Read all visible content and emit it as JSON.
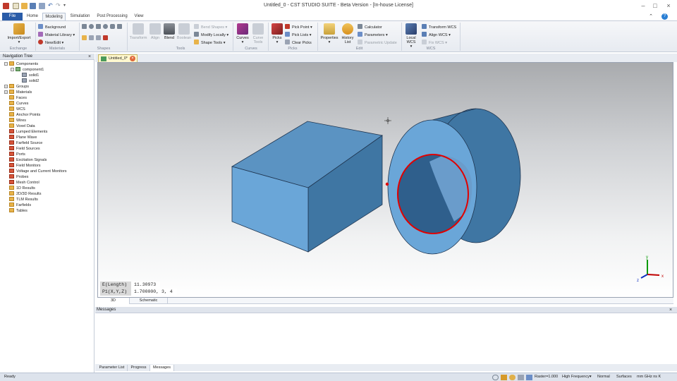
{
  "window": {
    "title": "Untitled_0 - CST STUDIO SUITE - Beta Version - [In-house License]"
  },
  "tabs": [
    "File",
    "Home",
    "Modeling",
    "Simulation",
    "Post Processing",
    "View"
  ],
  "ribbon": {
    "exchange": {
      "import_export": "Import/Export",
      "group": "Exchange"
    },
    "materials": {
      "background": "Background",
      "library": "Material Library",
      "new_edit": "New/Edit",
      "group": "Materials"
    },
    "shapes": {
      "group": "Shapes"
    },
    "tools": {
      "transform": "Transform",
      "align": "Align",
      "blend": "Blend",
      "boolean": "Boolean",
      "bend_shapes": "Bend Shapes",
      "modify_locally": "Modify Locally",
      "shape_tools": "Shape Tools",
      "group": "Tools"
    },
    "curves": {
      "curves": "Curves",
      "curve_tools": "Curve Tools",
      "group": "Curves"
    },
    "picks": {
      "picks": "Picks",
      "pick_point": "Pick Point",
      "pick_lists": "Pick Lists",
      "clear_picks": "Clear Picks",
      "group": "Picks"
    },
    "edit": {
      "properties": "Properties",
      "history": "History List",
      "calculator": "Calculator",
      "parameters": "Parameters",
      "param_update": "Parametric Update",
      "group": "Edit"
    },
    "wcs": {
      "local": "Local WCS",
      "transform": "Transform WCS",
      "align": "Align WCS",
      "fix": "Fix WCS",
      "group": "WCS"
    }
  },
  "nav": {
    "title": "Navigation Tree",
    "tree": [
      {
        "label": "Components",
        "indent": 0,
        "kind": "folder",
        "exp": "−"
      },
      {
        "label": "component1",
        "indent": 1,
        "kind": "comp",
        "exp": "−"
      },
      {
        "label": "solid1",
        "indent": 2,
        "kind": "solid",
        "exp": ""
      },
      {
        "label": "solid2",
        "indent": 2,
        "kind": "solid",
        "exp": ""
      },
      {
        "label": "Groups",
        "indent": 0,
        "kind": "folder",
        "exp": "+"
      },
      {
        "label": "Materials",
        "indent": 0,
        "kind": "folder",
        "exp": "+"
      },
      {
        "label": "Faces",
        "indent": 0,
        "kind": "folder",
        "exp": ""
      },
      {
        "label": "Curves",
        "indent": 0,
        "kind": "folder",
        "exp": ""
      },
      {
        "label": "WCS",
        "indent": 0,
        "kind": "folder",
        "exp": ""
      },
      {
        "label": "Anchor Points",
        "indent": 0,
        "kind": "folder",
        "exp": ""
      },
      {
        "label": "Wires",
        "indent": 0,
        "kind": "folder",
        "exp": ""
      },
      {
        "label": "Voxel Data",
        "indent": 0,
        "kind": "folder",
        "exp": ""
      },
      {
        "label": "Lumped Elements",
        "indent": 0,
        "kind": "red",
        "exp": ""
      },
      {
        "label": "Plane Wave",
        "indent": 0,
        "kind": "red",
        "exp": ""
      },
      {
        "label": "Farfield Source",
        "indent": 0,
        "kind": "red",
        "exp": ""
      },
      {
        "label": "Field Sources",
        "indent": 0,
        "kind": "red",
        "exp": ""
      },
      {
        "label": "Ports",
        "indent": 0,
        "kind": "red",
        "exp": ""
      },
      {
        "label": "Excitation Signals",
        "indent": 0,
        "kind": "red",
        "exp": ""
      },
      {
        "label": "Field Monitors",
        "indent": 0,
        "kind": "red",
        "exp": ""
      },
      {
        "label": "Voltage and Current Monitors",
        "indent": 0,
        "kind": "red",
        "exp": ""
      },
      {
        "label": "Probes",
        "indent": 0,
        "kind": "red",
        "exp": ""
      },
      {
        "label": "Mesh Control",
        "indent": 0,
        "kind": "red",
        "exp": ""
      },
      {
        "label": "1D Results",
        "indent": 0,
        "kind": "folder",
        "exp": ""
      },
      {
        "label": "2D/3D Results",
        "indent": 0,
        "kind": "folder",
        "exp": ""
      },
      {
        "label": "TLM Results",
        "indent": 0,
        "kind": "folder",
        "exp": ""
      },
      {
        "label": "Farfields",
        "indent": 0,
        "kind": "folder",
        "exp": ""
      },
      {
        "label": "Tables",
        "indent": 0,
        "kind": "folder",
        "exp": ""
      }
    ]
  },
  "document": {
    "tab": "Untitled_0*"
  },
  "readout": {
    "edge_label": "E(Length)",
    "edge_value": "11.30973",
    "point_label": "P1(X,Y,Z)",
    "point_value": "1.700000, 3, 4"
  },
  "axes": {
    "x": "x",
    "y": "y",
    "z": "z"
  },
  "view_tabs": [
    "3D",
    "Schematic"
  ],
  "messages": {
    "title": "Messages"
  },
  "bottom_tabs": [
    "Parameter List",
    "Progress",
    "Messages"
  ],
  "status": {
    "ready": "Ready",
    "raster": "Raster=1.000",
    "frequency": "High Frequency",
    "normal": "Normal",
    "surfaces": "Surfaces",
    "units": "mm  GHz  ns  K"
  },
  "colors": {
    "solid_blue": "#6aa6d8",
    "highlight": "#e00000",
    "accent": "#2a5ca8"
  }
}
